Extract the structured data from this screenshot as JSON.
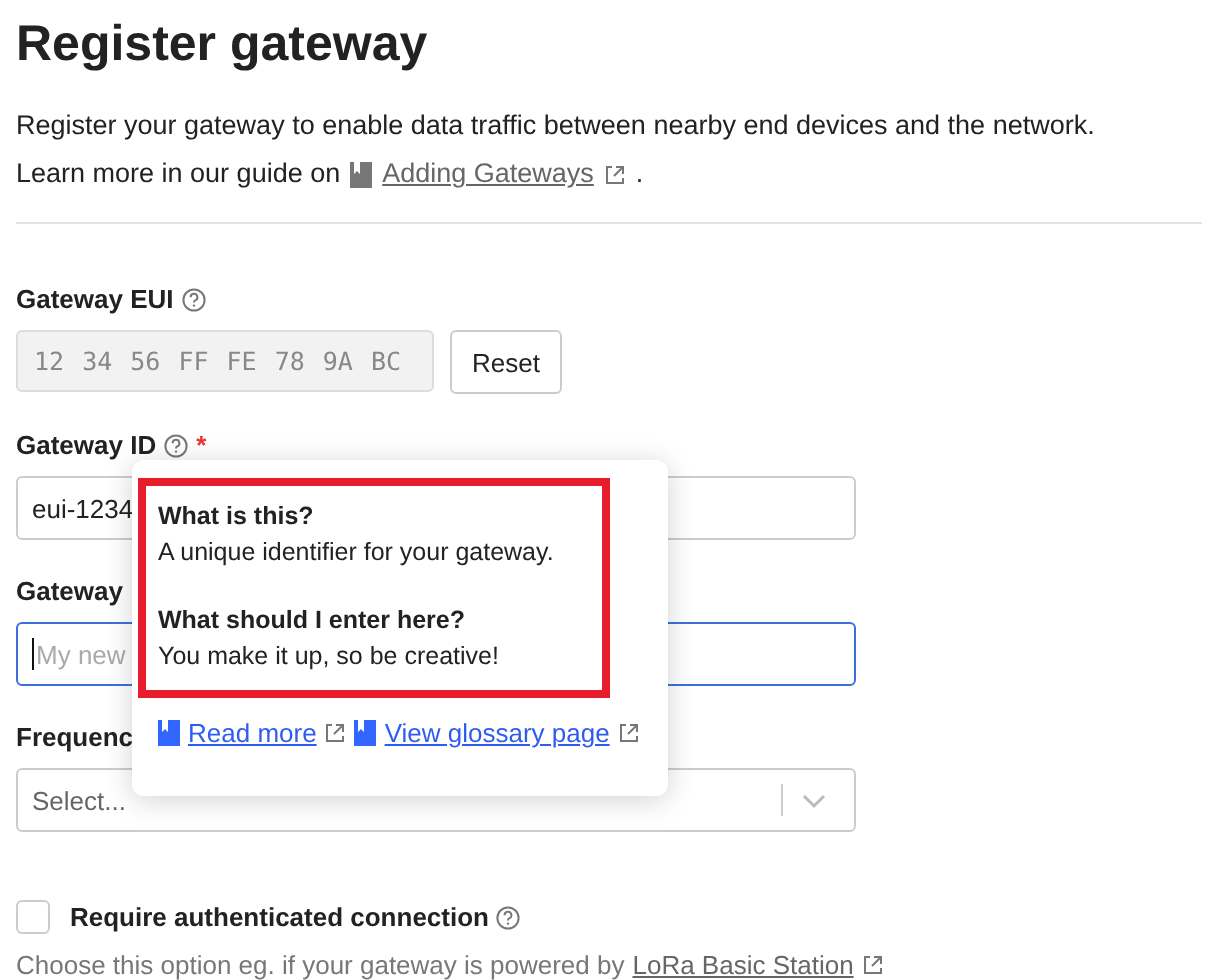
{
  "title": "Register gateway",
  "intro": {
    "line1": "Register your gateway to enable data traffic between nearby end devices and the network.",
    "line2_prefix": "Learn more in our guide on",
    "link": "Adding Gateways",
    "suffix": "."
  },
  "eui": {
    "label": "Gateway EUI",
    "bytes": [
      "12",
      "34",
      "56",
      "FF",
      "FE",
      "78",
      "9A",
      "BC"
    ],
    "reset": "Reset"
  },
  "gateway_id": {
    "label": "Gateway ID",
    "required": "*",
    "value": "eui-1234"
  },
  "gateway_name": {
    "label": "Gateway",
    "placeholder": "My new",
    "focused": true
  },
  "frequency": {
    "label": "Frequenc",
    "placeholder": "Select..."
  },
  "tooltip": {
    "q1": "What is this?",
    "a1": "A unique identifier for your gateway.",
    "q2": "What should I enter here?",
    "a2": "You make it up, so be creative!",
    "links": [
      "Read more",
      "View glossary page"
    ]
  },
  "auth": {
    "label": "Require authenticated connection",
    "checked": false,
    "help": "Choose this option eg. if your gateway is powered by",
    "help_link": "LoRa Basic Station"
  }
}
